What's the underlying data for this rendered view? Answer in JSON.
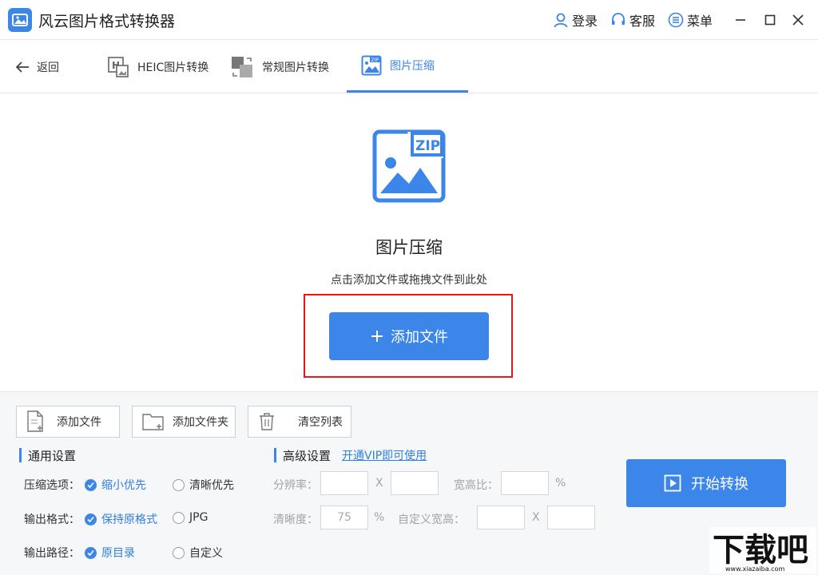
{
  "app": {
    "title": "风云图片格式转换器",
    "login": "登录",
    "support": "客服",
    "menu": "菜单"
  },
  "nav": {
    "back": "返回",
    "tabs": [
      {
        "label": "HEIC图片转换"
      },
      {
        "label": "常规图片转换"
      },
      {
        "label": "图片压缩"
      }
    ],
    "active_tab": 2
  },
  "dropzone": {
    "icon_text": "ZIP",
    "title": "图片压缩",
    "hint": "点击添加文件或拖拽文件到此处",
    "add_button": "添加文件"
  },
  "toolbar": {
    "add_file": "添加文件",
    "add_folder": "添加文件夹",
    "clear_list": "清空列表"
  },
  "general": {
    "title": "通用设置",
    "compress_label": "压缩选项：",
    "compress_opt1": "缩小优先",
    "compress_opt2": "清晰优先",
    "format_label": "输出格式：",
    "format_opt1": "保持原格式",
    "format_opt2": "JPG",
    "path_label": "输出路径：",
    "path_opt1": "原目录",
    "path_opt2": "自定义"
  },
  "advanced": {
    "title": "高级设置",
    "vip_link": "开通VIP即可使用",
    "resolution_label": "分辨率：",
    "x_sep": "X",
    "ratio_label": "宽高比：",
    "percent": "%",
    "clarity_label": "清晰度：",
    "clarity_value": "75",
    "custom_size_label": "自定义宽高："
  },
  "start_button": "开始转换",
  "watermark": {
    "brand": "下载吧",
    "url": "www.xiazaiba.com"
  },
  "colors": {
    "accent": "#3b86e8",
    "highlight": "#e0191e"
  }
}
